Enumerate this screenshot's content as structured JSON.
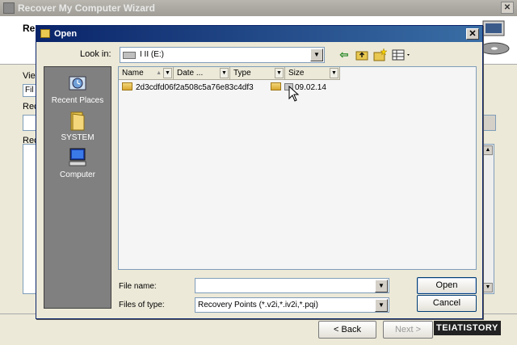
{
  "wizard": {
    "title": "Recover My Computer Wizard",
    "header_title": "Re",
    "labels": [
      "Vie",
      "Fil",
      "Rec",
      "Rec"
    ],
    "back_label": "< Back",
    "next_label": "Next >"
  },
  "watermark": "TEIATISTORY",
  "dialog": {
    "title": "Open",
    "look_in_label": "Look in:",
    "look_in_value": "I II (E:)",
    "places": [
      {
        "label": "Recent Places",
        "icon": "recent-places-icon"
      },
      {
        "label": "SYSTEM",
        "icon": "folder-icon"
      },
      {
        "label": "Computer",
        "icon": "computer-icon"
      }
    ],
    "columns": [
      "Name",
      "Date ...",
      "Type",
      "Size"
    ],
    "items": [
      {
        "name": "2d3cdfd06f2a508c5a76e83c4df3",
        "type": "folder"
      },
      {
        "name": "09.02.14",
        "type": "file"
      }
    ],
    "file_name_label": "File name:",
    "file_name_value": "",
    "files_of_type_label": "Files of type:",
    "files_of_type_value": "Recovery Points (*.v2i,*.iv2i,*.pqi)",
    "open_label": "Open",
    "cancel_label": "Cancel"
  }
}
